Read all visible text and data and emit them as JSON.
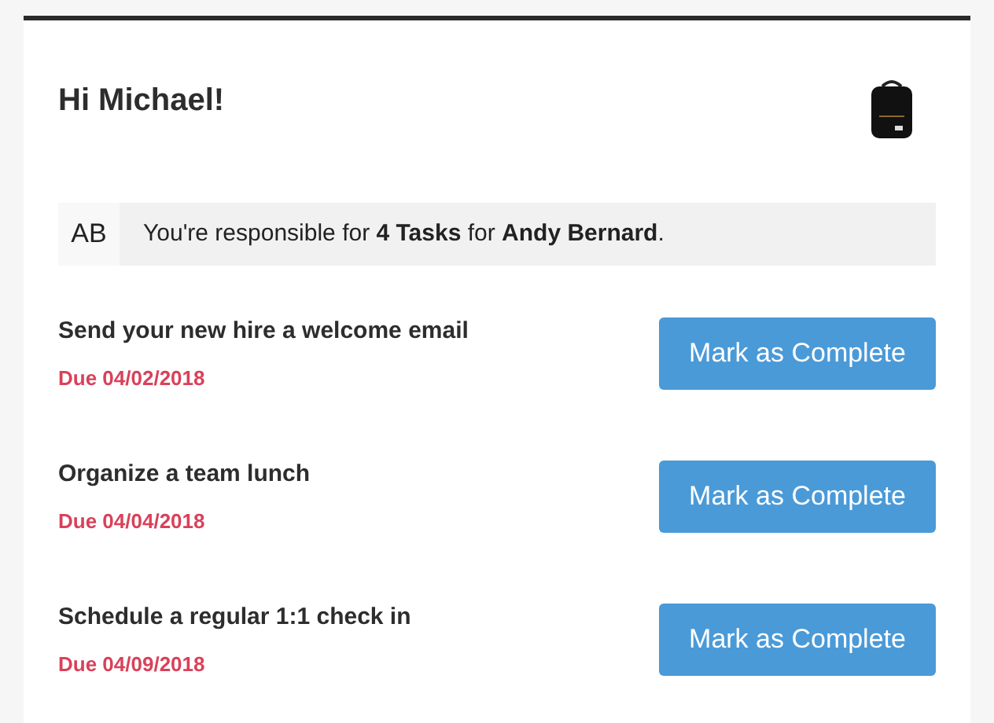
{
  "greeting": "Hi Michael!",
  "banner": {
    "initials": "AB",
    "message": "You're responsible for **4 Tasks** for **Andy Bernard**."
  },
  "tasks": [
    {
      "title": "Send your new hire a welcome email",
      "due": "Due 04/02/2018",
      "button": "Mark as Complete"
    },
    {
      "title": "Organize a team lunch",
      "due": "Due 04/04/2018",
      "button": "Mark as Complete"
    },
    {
      "title": "Schedule a regular 1:1 check in",
      "due": "Due 04/09/2018",
      "button": "Mark as Complete"
    }
  ]
}
